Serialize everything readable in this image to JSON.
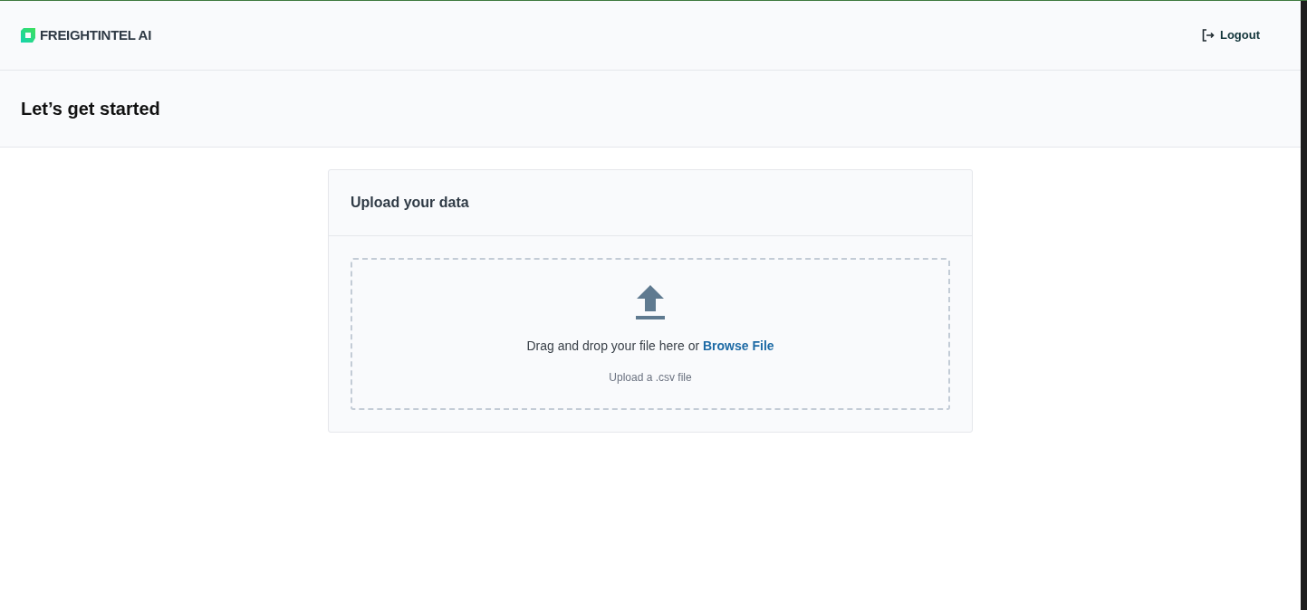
{
  "header": {
    "brand": "FREIGHTINTEL AI",
    "logout": "Logout"
  },
  "page": {
    "title": "Let’s get started"
  },
  "card": {
    "title": "Upload your data",
    "dropzone": {
      "prompt": "Drag and drop your file here or",
      "link": "Browse File",
      "hint": "Upload a .csv file"
    }
  }
}
